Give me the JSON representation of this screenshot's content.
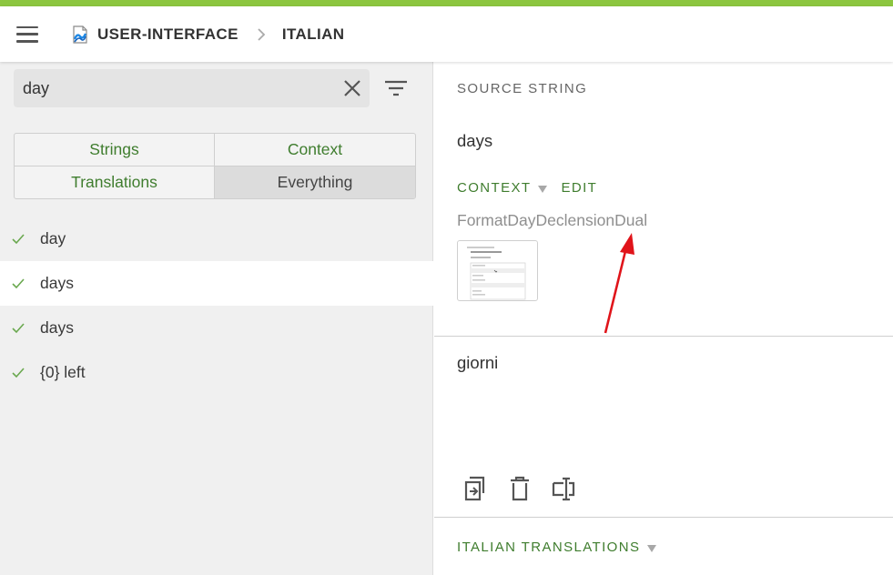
{
  "colors": {
    "accent": "#8cc63f",
    "green_text": "#3f7d2e",
    "annotation_arrow": "#e0141a"
  },
  "header": {
    "menu_icon": "hamburger-menu-icon",
    "project_icon": "project-logo-icon",
    "project": "USER-INTERFACE",
    "separator_icon": "chevron-right-icon",
    "locale": "ITALIAN"
  },
  "sidebar": {
    "search": {
      "value": "day",
      "clear_icon": "close-icon",
      "filter_icon": "filter-icon"
    },
    "filters": [
      {
        "label": "Strings",
        "active": false
      },
      {
        "label": "Context",
        "active": false
      },
      {
        "label": "Translations",
        "active": false
      },
      {
        "label": "Everything",
        "active": true
      }
    ],
    "items": [
      {
        "label": "day",
        "translated": true,
        "selected": false
      },
      {
        "label": "days",
        "translated": true,
        "selected": true
      },
      {
        "label": "days",
        "translated": true,
        "selected": false
      },
      {
        "label": "{0} left",
        "translated": true,
        "selected": false
      }
    ]
  },
  "editor": {
    "source_label": "SOURCE STRING",
    "source_text": "days",
    "context_label": "CONTEXT",
    "edit_label": "EDIT",
    "context_value": "FormatDayDeclensionDual",
    "screenshot_icon": "screenshot-thumbnail",
    "translation": "giorni",
    "tools": [
      "copy-source-icon",
      "delete-icon",
      "text-cursor-icon"
    ],
    "italian_translations_label": "ITALIAN TRANSLATIONS"
  }
}
